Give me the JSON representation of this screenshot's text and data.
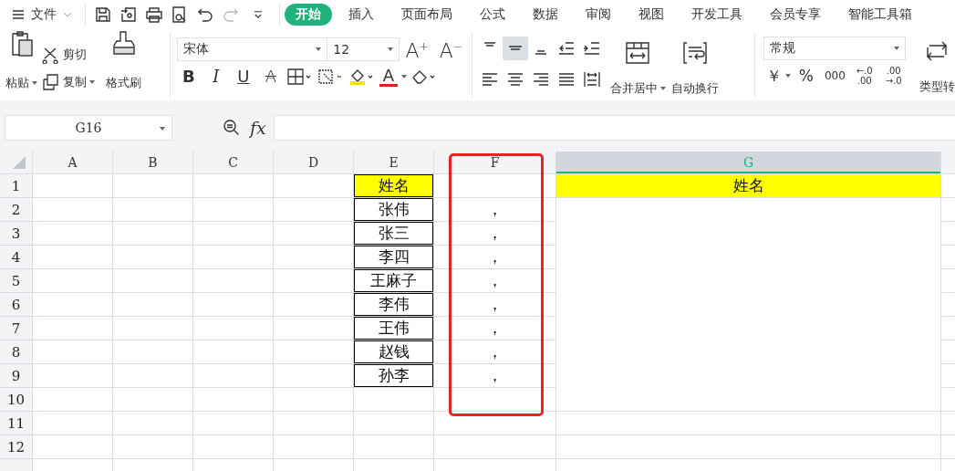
{
  "file_menu": "文件",
  "tabs": [
    {
      "label": "开始",
      "selected": true
    },
    {
      "label": "插入",
      "selected": false
    },
    {
      "label": "页面布局",
      "selected": false
    },
    {
      "label": "公式",
      "selected": false
    },
    {
      "label": "数据",
      "selected": false
    },
    {
      "label": "审阅",
      "selected": false
    },
    {
      "label": "视图",
      "selected": false
    },
    {
      "label": "开发工具",
      "selected": false
    },
    {
      "label": "会员专享",
      "selected": false
    },
    {
      "label": "智能工具箱",
      "selected": false
    }
  ],
  "ribbon": {
    "paste": "粘贴",
    "cut": "剪切",
    "copy": "复制",
    "format_painter": "格式刷",
    "font": "宋体",
    "font_size": "12",
    "grow": "A",
    "grow_sign": "+",
    "shrink": "A",
    "shrink_sign": "−",
    "bold": "B",
    "italic": "I",
    "underline": "U",
    "strike": "A",
    "font_color": "A",
    "alignment": [
      {
        "kind": "top",
        "selected": false
      },
      {
        "kind": "middle",
        "selected": true
      },
      {
        "kind": "bottom",
        "selected": false
      },
      {
        "kind": "outdent",
        "selected": false
      },
      {
        "kind": "indent",
        "selected": false
      },
      {
        "kind": "left",
        "selected": false
      },
      {
        "kind": "center",
        "selected": false
      },
      {
        "kind": "right",
        "selected": false
      },
      {
        "kind": "justify",
        "selected": false
      },
      {
        "kind": "distribute",
        "selected": false
      }
    ],
    "merge": "合并居中",
    "wrap": "自动换行",
    "number_format": "常规",
    "currency": "￥",
    "percent": "%",
    "thousands": "000",
    "decimals": [
      {
        "top": "←.0",
        "bottom": ".00"
      },
      {
        "top": ".00",
        "bottom": "→.0"
      }
    ],
    "type_convert": "类型转"
  },
  "name_box": "G16",
  "fx": "fx",
  "columns": [
    {
      "label": "A",
      "selected": false
    },
    {
      "label": "B",
      "selected": false
    },
    {
      "label": "C",
      "selected": false
    },
    {
      "label": "D",
      "selected": false
    },
    {
      "label": "E",
      "selected": false
    },
    {
      "label": "F",
      "selected": false
    },
    {
      "label": "G",
      "selected": true
    },
    {
      "selected": false
    }
  ],
  "rows": [
    {
      "label": "1",
      "cells": {
        "col_5": {
          "text": "姓名",
          "highlighted": true,
          "bordered": true
        },
        "col_7": {
          "text": "姓名",
          "highlighted": true,
          "bordered": false
        }
      }
    },
    {
      "label": "2",
      "cells": {
        "col_5": {
          "text": "张伟",
          "highlighted": false,
          "bordered": true
        },
        "col_6": {
          "text": "，",
          "highlighted": false,
          "bordered": false
        }
      }
    },
    {
      "label": "3",
      "cells": {
        "col_5": {
          "text": "张三",
          "highlighted": false,
          "bordered": true
        },
        "col_6": {
          "text": "，",
          "highlighted": false,
          "bordered": false
        },
        "col_7": {
          "merged_up": true
        }
      }
    },
    {
      "label": "4",
      "cells": {
        "col_5": {
          "text": "李四",
          "highlighted": false,
          "bordered": true
        },
        "col_6": {
          "text": "，",
          "highlighted": false,
          "bordered": false
        },
        "col_7": {
          "merged_up": true
        }
      }
    },
    {
      "label": "5",
      "cells": {
        "col_5": {
          "text": "王麻子",
          "highlighted": false,
          "bordered": true
        },
        "col_6": {
          "text": "，",
          "highlighted": false,
          "bordered": false
        },
        "col_7": {
          "merged_up": true
        }
      }
    },
    {
      "label": "6",
      "cells": {
        "col_5": {
          "text": "李伟",
          "highlighted": false,
          "bordered": true
        },
        "col_6": {
          "text": "，",
          "highlighted": false,
          "bordered": false
        },
        "col_7": {
          "merged_up": true
        }
      }
    },
    {
      "label": "7",
      "cells": {
        "col_5": {
          "text": "王伟",
          "highlighted": false,
          "bordered": true
        },
        "col_6": {
          "text": "，",
          "highlighted": false,
          "bordered": false
        },
        "col_7": {
          "merged_up": true
        }
      }
    },
    {
      "label": "8",
      "cells": {
        "col_5": {
          "text": "赵钱",
          "highlighted": false,
          "bordered": true
        },
        "col_6": {
          "text": "，",
          "highlighted": false,
          "bordered": false
        },
        "col_7": {
          "merged_up": true
        }
      }
    },
    {
      "label": "9",
      "cells": {
        "col_5": {
          "text": "孙李",
          "highlighted": false,
          "bordered": true
        },
        "col_6": {
          "text": "，",
          "highlighted": false,
          "bordered": false
        },
        "col_7": {
          "merged_up": true
        }
      }
    },
    {
      "label": "10",
      "cells": {
        "col_7": {
          "merged_up": true
        }
      }
    },
    {
      "label": "11"
    },
    {
      "label": "12"
    },
    {}
  ]
}
